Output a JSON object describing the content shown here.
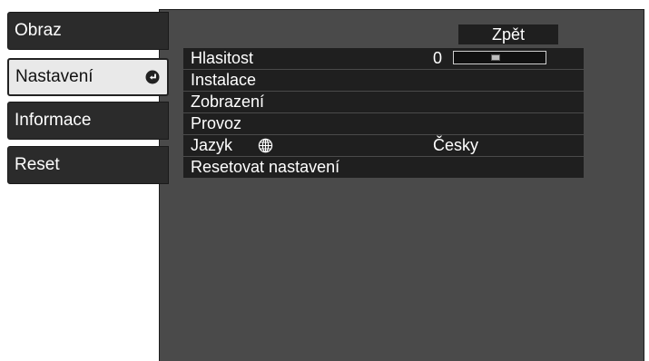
{
  "sidebar": {
    "tabs": [
      {
        "label": "Obraz",
        "selected": false
      },
      {
        "label": "Nastavení",
        "selected": true,
        "icon": "enter-icon"
      },
      {
        "label": "Informace",
        "selected": false
      },
      {
        "label": "Reset",
        "selected": false
      }
    ]
  },
  "panel": {
    "back_label": "Zpět",
    "items": [
      {
        "label": "Hlasitost",
        "value": "0",
        "slider_level": 0.45
      },
      {
        "label": "Instalace"
      },
      {
        "label": "Zobrazení"
      },
      {
        "label": "Provoz"
      },
      {
        "label": "Jazyk",
        "icon": "globe-icon",
        "value": "Česky"
      },
      {
        "label": "Resetovat nastavení"
      }
    ]
  },
  "colors": {
    "panel_bg": "#4a4a4a",
    "row_bg": "#1f1f1f",
    "tab_bg": "#2b2b2b",
    "tab_selected_bg": "#e9e9e9"
  }
}
